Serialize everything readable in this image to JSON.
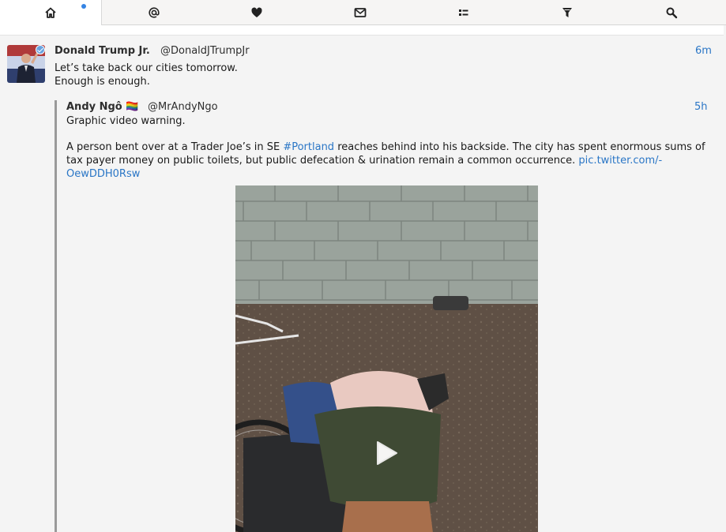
{
  "toolbar": {
    "tabs": [
      {
        "name": "home",
        "icon": "home-icon",
        "active": true,
        "unread": true
      },
      {
        "name": "mentions",
        "icon": "at-icon"
      },
      {
        "name": "favorites",
        "icon": "heart-icon"
      },
      {
        "name": "messages",
        "icon": "mail-icon"
      },
      {
        "name": "lists",
        "icon": "list-icon"
      },
      {
        "name": "filters",
        "icon": "filter-icon"
      },
      {
        "name": "search",
        "icon": "search-icon"
      }
    ],
    "accent_color": "#3584e4"
  },
  "tweet": {
    "author_name": "Donald Trump Jr.",
    "author_handle": "@DonaldJTrumpJr",
    "time": "6m",
    "lines": [
      "Let’s take back our cities tomorrow.",
      "Enough is enough."
    ],
    "verified": true
  },
  "quote": {
    "author_name": "Andy Ngô 🏳️‍🌈",
    "author_handle": "@MrAndyNgo",
    "time": "5h",
    "warning": "Graphic video warning.",
    "body_part1": "A person bent over at a Trader Joe’s in SE ",
    "hashtag": "#Portland",
    "body_part2": " reaches behind into his backside. The city has spent enormous sums of tax payer money on public toilets, but public defecation & urination remain a common occurrence. ",
    "link": "pic.twitter.com/-OewDDH0Rsw",
    "media_icon": "play-icon",
    "link_color": "#2a76c6"
  }
}
